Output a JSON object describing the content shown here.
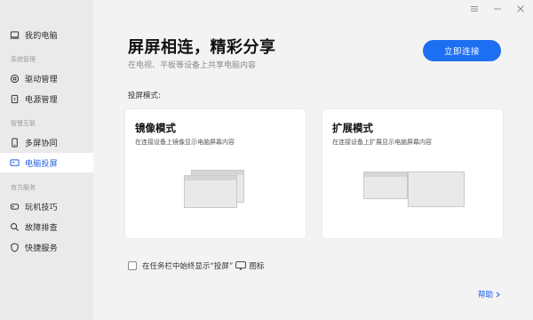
{
  "sidebar": {
    "items": [
      {
        "label": "我的电脑",
        "icon": "laptop-icon"
      },
      {
        "label": "驱动管理",
        "icon": "driver-icon"
      },
      {
        "label": "电源管理",
        "icon": "power-icon"
      },
      {
        "label": "多屏协同",
        "icon": "phone-icon"
      },
      {
        "label": "电脑投屏",
        "icon": "projection-icon"
      },
      {
        "label": "玩机技巧",
        "icon": "tips-icon"
      },
      {
        "label": "故障排查",
        "icon": "search-icon"
      },
      {
        "label": "快捷服务",
        "icon": "shield-icon"
      }
    ],
    "sections": {
      "system": "系统管理",
      "smart": "智慧互联",
      "official": "官方服务"
    },
    "active_item": "电脑投屏"
  },
  "header": {
    "title": "屏屏相连，精彩分享",
    "subtitle": "在电视、平板等设备上共享电脑内容",
    "connect_label": "立即连接"
  },
  "mode_label": "投屏模式:",
  "cards": {
    "mirror": {
      "title": "镜像模式",
      "desc": "在连接设备上镜像显示电脑屏幕内容"
    },
    "extend": {
      "title": "扩展模式",
      "desc": "在连接设备上扩展显示电脑屏幕内容"
    }
  },
  "taskbar_option": {
    "prefix": "在任务栏中始终显示“投屏”",
    "suffix": "图标",
    "checked": false
  },
  "help_label": "帮助",
  "colors": {
    "accent": "#1d6ff2",
    "active_text": "#1f5ee6",
    "sidebar_bg": "#eaeaea",
    "main_bg": "#f3f3f3"
  }
}
